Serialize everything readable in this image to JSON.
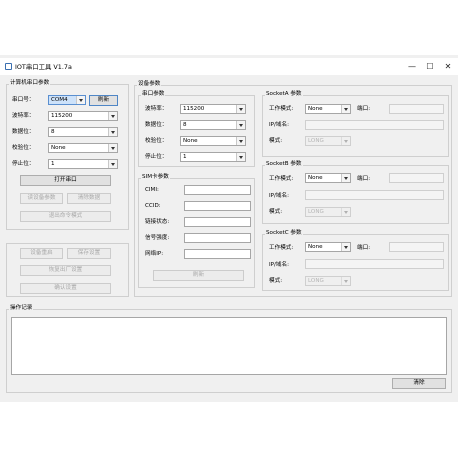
{
  "window": {
    "title": "IOT串口工具 V1.7a",
    "minimize": "—",
    "maximize": "☐",
    "close": "✕"
  },
  "serial": {
    "group_title": "计算机串口参数",
    "port_label": "串口号：",
    "port_value": "COM4",
    "refresh_label": "刷新",
    "baud_label": "波特率：",
    "baud_value": "115200",
    "databits_label": "数据位：",
    "databits_value": "8",
    "parity_label": "校验位：",
    "parity_value": "None",
    "stopbits_label": "停止位：",
    "stopbits_value": "1",
    "open_label": "打开串口",
    "read_params_label": "读设备参数",
    "clear_data_label": "清除数据",
    "exit_cmd_label": "退出命令模式",
    "device_restart_label": "设备重启",
    "save_settings_label": "保存设置",
    "factory_reset_label": "恢复出厂设置",
    "confirm_settings_label": "确认设置"
  },
  "device": {
    "group_title": "设备参数",
    "serial_params": {
      "title": "串口参数",
      "baud_label": "波特率：",
      "baud_value": "115200",
      "databits_label": "数据位：",
      "databits_value": "8",
      "parity_label": "校验位：",
      "parity_value": "None",
      "stopbits_label": "停止位：",
      "stopbits_value": "1"
    },
    "sim": {
      "title": "SIM卡参数",
      "cimi_label": "CIMI:",
      "ccid_label": "CCID:",
      "link_label": "链接状态:",
      "signal_label": "信号强度:",
      "ip_label": "网络IP:",
      "refresh_label": "刷新"
    },
    "sockets": [
      {
        "title": "SocketA 参数",
        "mode_label": "工作模式:",
        "mode_value": "None",
        "port_label": "端口:",
        "ip_label": "IP/域名:",
        "pattern_label": "模式:",
        "pattern_value": "LONG"
      },
      {
        "title": "SocketB 参数",
        "mode_label": "工作模式:",
        "mode_value": "None",
        "port_label": "端口:",
        "ip_label": "IP/域名:",
        "pattern_label": "模式:",
        "pattern_value": "LONG"
      },
      {
        "title": "SocketC 参数",
        "mode_label": "工作模式:",
        "mode_value": "None",
        "port_label": "端口:",
        "ip_label": "IP/域名:",
        "pattern_label": "模式:",
        "pattern_value": "LONG"
      }
    ]
  },
  "log": {
    "group_title": "操作记录",
    "clear_label": "清除"
  }
}
